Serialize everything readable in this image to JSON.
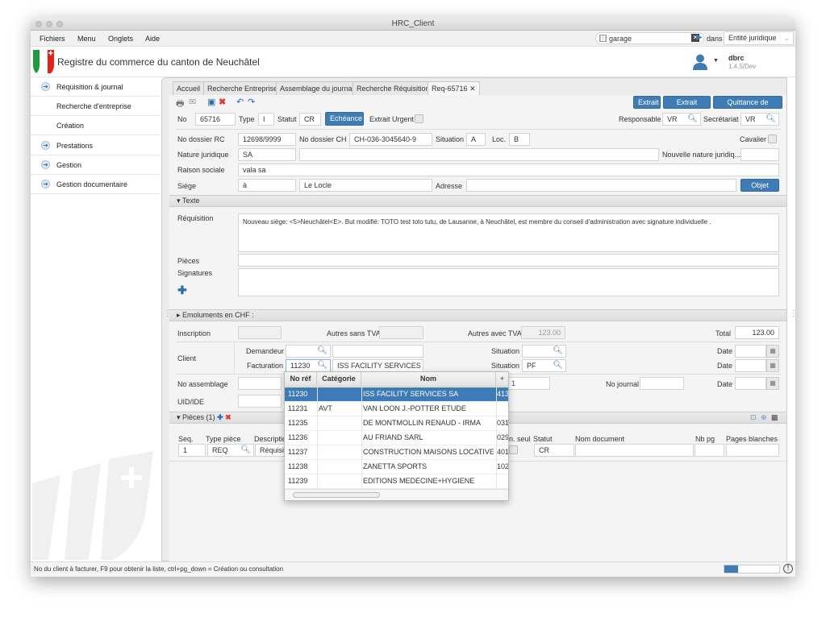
{
  "window": {
    "title": "HRC_Client"
  },
  "menu": [
    "Fichiers",
    "Menu",
    "Onglets",
    "Aide"
  ],
  "search": {
    "value": "garage",
    "in_label": "dans",
    "scope": "Entité juridique"
  },
  "header": {
    "title": "Registre du commerce du canton de Neuchâtel",
    "user": "dbrc",
    "version": "1.4.5/Dev"
  },
  "sidebar": {
    "items": [
      {
        "label": "Réquisition & journal",
        "icon": "arrow-circle"
      },
      {
        "label": "Recherche d'entreprise"
      },
      {
        "label": "Création"
      },
      {
        "label": "Prestations",
        "icon": "arrow-circle"
      },
      {
        "label": "Gestion",
        "icon": "arrow-circle"
      },
      {
        "label": "Gestion documentaire",
        "icon": "arrow-circle"
      }
    ]
  },
  "tabs": [
    "Accueil",
    "Recherche Entreprise",
    "Assemblage du journal",
    "Recherche Réquisition",
    "Req-65716"
  ],
  "toolbar": {
    "extrait": "Extrait",
    "extrait_limite": "Extrait limité",
    "quittance": "Quittance de caisse"
  },
  "form": {
    "no_label": "No",
    "no": "65716",
    "type_label": "Type",
    "type": "I",
    "statut_label": "Statut",
    "statut": "CR",
    "echeance": "Echéance",
    "extrait_urgent": "Extrait Urgent",
    "responsable_label": "Responsable",
    "responsable": "VR",
    "secretariat_label": "Secrétariat",
    "secretariat": "VR",
    "dossier_rc_label": "No dossier RC",
    "dossier_rc": "12698/9999",
    "dossier_ch_label": "No dossier CH",
    "dossier_ch": "CH-036-3045640-9",
    "situation_label": "Situation",
    "situation": "A",
    "loc_label": "Loc.",
    "loc": "B",
    "cavalier": "Cavalier",
    "nature_label": "Nature juridique",
    "nature": "SA",
    "nouvelle_nature_label": "Nouvelle nature juridiq...",
    "raison_label": "Raison sociale",
    "raison": "vala sa",
    "siege_label": "Siège",
    "siege_prefix": "à",
    "siege": "Le Locle",
    "adresse_label": "Adresse",
    "objet": "Objet e..."
  },
  "texte": {
    "section": "Texte",
    "requisition_label": "Réquisition",
    "requisition": "Nouveau siège: <5>Neuchâtel<E>. But modifié: TOTO test toto tutu, de Lausanne, à Neuchâtel, est membre du conseil d'administration avec signature individuelle .",
    "pieces_label": "Pièces",
    "signatures_label": "Signatures"
  },
  "emoluments": {
    "section": "Emoluments en CHF :",
    "inscription": "Inscription",
    "autres_sans": "Autres sans TVA",
    "autres_avec": "Autres avec TVA",
    "autres_avec_value": "123.00",
    "total_label": "Total",
    "total": "123.00",
    "client": "Client",
    "demandeur": "Demandeur",
    "facturation": "Facturation",
    "facturation_no": "11230",
    "facturation_nom": "ISS FACILITY SERVICES SA",
    "situation": "Situation",
    "situation_fact": "PF",
    "date": "Date",
    "no_assemblage": "No assemblage",
    "assemblage_tail": "1",
    "no_journal": "No journal",
    "uid": "UID/IDE"
  },
  "pieces": {
    "section": "Pièces (1)",
    "columns": [
      "Seq.",
      "Type pièce",
      "Descriptio",
      "n. seul",
      "Statut",
      "Nom document",
      "Nb pg",
      "Pages blanches"
    ],
    "row": {
      "seq": "1",
      "type": "REQ",
      "desc": "Réquisiti",
      "statut": "CR"
    }
  },
  "popup": {
    "columns": [
      "No réf",
      "Catégorie",
      "Nom",
      "+"
    ],
    "rows": [
      {
        "ref": "11230",
        "cat": "",
        "nom": "ISS FACILITY SERVICES SA",
        "extra": "413",
        "selected": true
      },
      {
        "ref": "11231",
        "cat": "AVT",
        "nom": "VAN LOON J.-POTTER ETUDE",
        "extra": ""
      },
      {
        "ref": "11235",
        "cat": "",
        "nom": "DE MONTMOLLIN RENAUD - IRMA",
        "extra": "031"
      },
      {
        "ref": "11236",
        "cat": "",
        "nom": "AU FRIAND SARL",
        "extra": "029"
      },
      {
        "ref": "11237",
        "cat": "",
        "nom": "CONSTRUCTION MAISONS LOCATIVES",
        "extra": "401"
      },
      {
        "ref": "11238",
        "cat": "",
        "nom": "ZANETTA SPORTS",
        "extra": "102"
      },
      {
        "ref": "11239",
        "cat": "",
        "nom": "EDITIONS MEDECINE+HYGIENE",
        "extra": ""
      }
    ]
  },
  "status": {
    "text": "No du client à facturer, F9 pour obtenir la liste, ctrl+pg_down = Création ou consultation",
    "progress": 0.25
  },
  "colors": {
    "accent": "#3f7cb5",
    "selection": "#3d7ab8"
  }
}
